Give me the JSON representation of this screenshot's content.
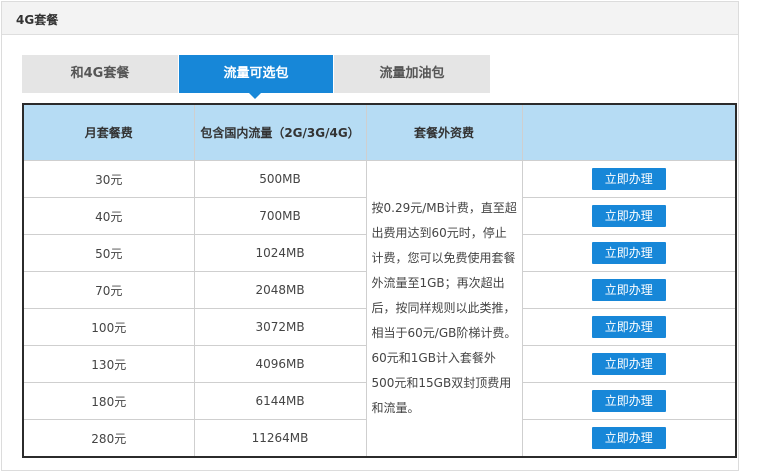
{
  "panel": {
    "title": "4G套餐"
  },
  "tabs": [
    {
      "label": "和4G套餐",
      "active": false
    },
    {
      "label": "流量可选包",
      "active": true
    },
    {
      "label": "流量加油包",
      "active": false
    }
  ],
  "colors": {
    "accent": "#1787d8",
    "header_bg": "#b6dcf4",
    "tab_bg": "#e5e5e5"
  },
  "table": {
    "headers": [
      "月套餐费",
      "包含国内流量（2G/3G/4G）",
      "套餐外资费",
      ""
    ],
    "note": "按0.29元/MB计费，直至超出费用达到60元时，停止计费，您可以免费使用套餐外流量至1GB；再次超出后，按同样规则以此类推，相当于60元/GB阶梯计费。60元和1GB计入套餐外500元和15GB双封顶费用和流量。",
    "rows": [
      {
        "fee": "30元",
        "data": "500MB",
        "action": "立即办理"
      },
      {
        "fee": "40元",
        "data": "700MB",
        "action": "立即办理"
      },
      {
        "fee": "50元",
        "data": "1024MB",
        "action": "立即办理"
      },
      {
        "fee": "70元",
        "data": "2048MB",
        "action": "立即办理"
      },
      {
        "fee": "100元",
        "data": "3072MB",
        "action": "立即办理"
      },
      {
        "fee": "130元",
        "data": "4096MB",
        "action": "立即办理"
      },
      {
        "fee": "180元",
        "data": "6144MB",
        "action": "立即办理"
      },
      {
        "fee": "280元",
        "data": "11264MB",
        "action": "立即办理"
      }
    ]
  }
}
